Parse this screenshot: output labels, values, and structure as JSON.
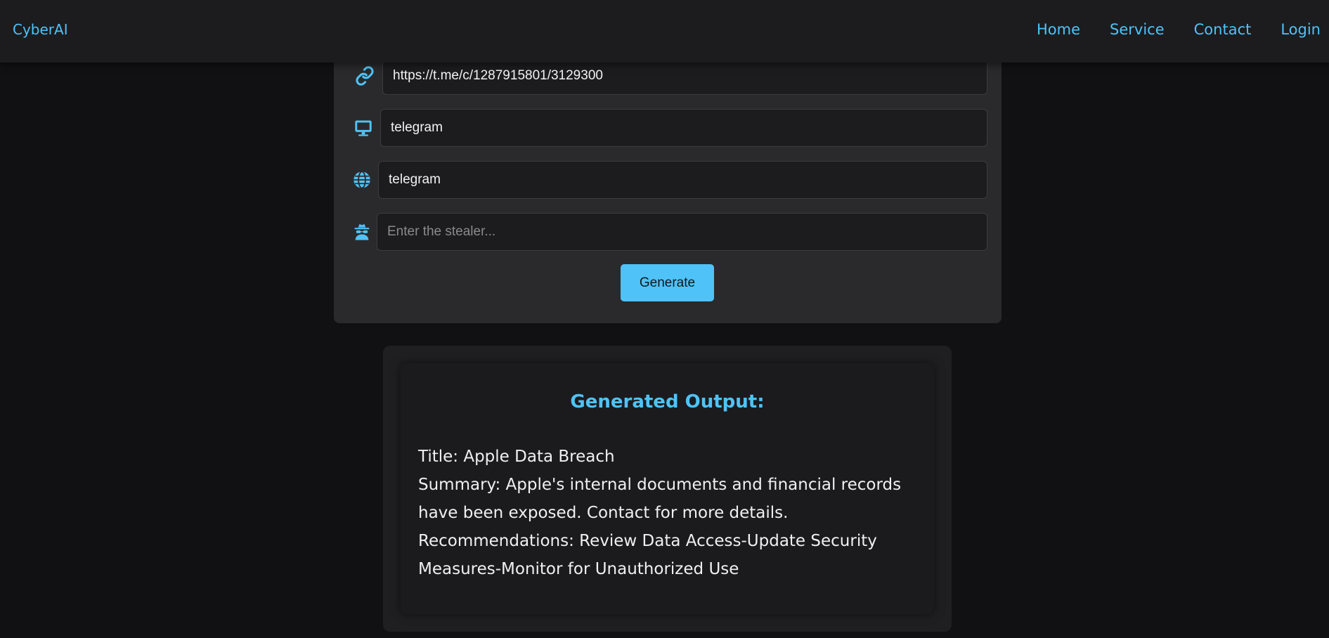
{
  "navbar": {
    "brand": "CyberAI",
    "links": [
      "Home",
      "Service",
      "Contact",
      "Login"
    ]
  },
  "form": {
    "fields": [
      {
        "icon": "link-icon",
        "value": "https://t.me/c/1287915801/3129300",
        "placeholder": ""
      },
      {
        "icon": "monitor-icon",
        "value": "telegram",
        "placeholder": ""
      },
      {
        "icon": "globe-icon",
        "value": "telegram",
        "placeholder": ""
      },
      {
        "icon": "spy-icon",
        "value": "",
        "placeholder": "Enter the stealer..."
      }
    ],
    "generate_label": "Generate"
  },
  "output": {
    "heading": "Generated Output:",
    "title_line": "Title: Apple Data Breach",
    "summary_line": "Summary: Apple's internal documents and financial records have been exposed. Contact for more details.",
    "recommendations_line": "Recommendations: Review Data Access-Update Security Measures-Monitor for Unauthorized Use"
  },
  "colors": {
    "accent": "#4fc3f7",
    "background": "#111114",
    "card": "#2a2a2d",
    "navbar": "#1c1c1f"
  }
}
